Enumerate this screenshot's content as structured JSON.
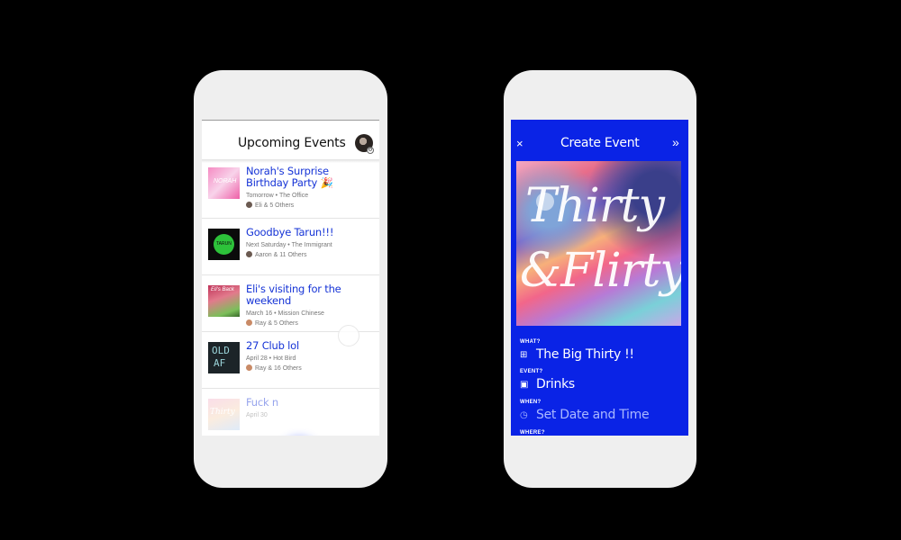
{
  "left_screen": {
    "title": "Upcoming Events",
    "events": [
      {
        "title": "Norah's Surprise Birthday Party 🎉",
        "meta": "Tomorrow • The Office",
        "people": "Eli & 5 Others",
        "thumb_colors": [
          "#f06fb0",
          "#f9c8e6"
        ]
      },
      {
        "title": "Goodbye Tarun!!!",
        "meta": "Next Saturday • The Immigrant",
        "people": "Aaron & 11 Others",
        "thumb_colors": [
          "#0b0b0b",
          "#2dc23a"
        ]
      },
      {
        "title": "Eli's visiting for the weekend",
        "meta": "March 16 • Mission Chinese",
        "people": "Ray & 5 Others",
        "thumb_colors": [
          "#c0345a",
          "#7bbf5a"
        ]
      },
      {
        "title": "27 Club lol",
        "meta": "April 28 • Hot Bird",
        "people": "Ray & 16 Others",
        "thumb_colors": [
          "#1c2428",
          "#9ad3d8"
        ]
      },
      {
        "title": "Fuck n",
        "meta": "April 30",
        "people": "",
        "thumb_colors": [
          "#f3b6cf",
          "#b9d4f2"
        ]
      }
    ],
    "fab_label": "+",
    "thumb_texts": {
      "norah": "NORAH",
      "goodbye": "TARUN",
      "eli": "Eli's Back",
      "club_top": "OLD",
      "club_bottom": "AF",
      "thirty": "Thirty"
    }
  },
  "right_screen": {
    "header": {
      "close": "×",
      "title": "Create Event",
      "next": "»"
    },
    "artwork_lines": [
      "Thirty",
      "&Flirty"
    ],
    "fields": [
      {
        "label": "WHAT?",
        "icon": "⊞",
        "icon_name": "grid-icon",
        "value": "The Big Thirty !!",
        "placeholder": false
      },
      {
        "label": "EVENT?",
        "icon": "▣",
        "icon_name": "calendar-icon",
        "value": "Drinks",
        "placeholder": false
      },
      {
        "label": "WHEN?",
        "icon": "◷",
        "icon_name": "clock-icon",
        "value": "Set Date and Time",
        "placeholder": true
      },
      {
        "label": "WHERE?",
        "icon": "",
        "icon_name": "",
        "value": "",
        "placeholder": false
      }
    ]
  },
  "colors": {
    "accent_blue": "#1533d6",
    "create_bg": "#0a23e6",
    "background": "#000000",
    "phone": "#efefef"
  }
}
